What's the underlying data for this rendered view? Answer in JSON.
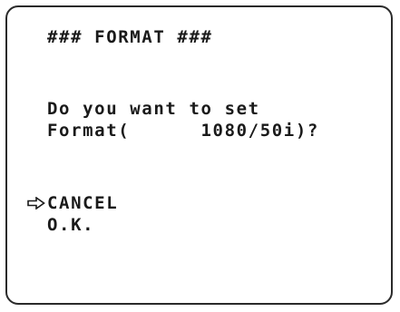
{
  "screen": {
    "title": "### FORMAT ###",
    "question_line1": "Do you want to set",
    "question_line2": "Format(      1080/50i)?"
  },
  "menu": {
    "cursor_icon": "right-arrow-outline-icon",
    "selected_index": 0,
    "items": [
      {
        "label": "CANCEL"
      },
      {
        "label": "O.K."
      }
    ]
  }
}
